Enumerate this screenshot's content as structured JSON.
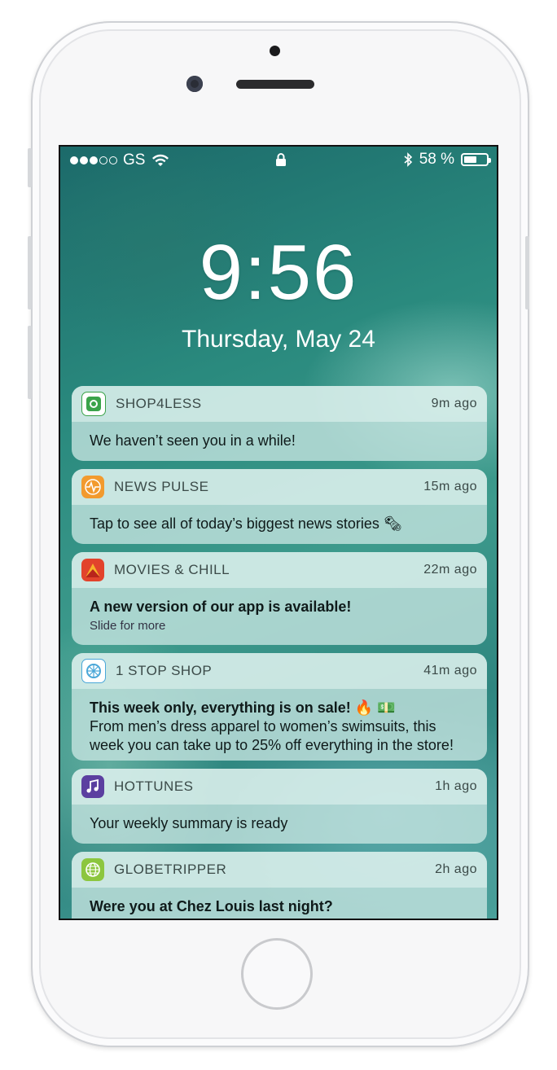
{
  "status_bar": {
    "carrier": "GS",
    "battery_text": "58 %",
    "battery_level": 0.58
  },
  "lock_screen": {
    "time": "9:56",
    "date": "Thursday, May 24"
  },
  "notifications": [
    {
      "app": "SHOP4LESS",
      "ago": "9m ago",
      "title": "",
      "message": "We haven’t seen you in a while!",
      "sub": "",
      "icon": "shop4less-icon"
    },
    {
      "app": "NEWS PULSE",
      "ago": "15m ago",
      "title": "",
      "message": "Tap to see all of today’s biggest news stories 🗞",
      "sub": "",
      "icon": "news-pulse-icon"
    },
    {
      "app": "MOVIES & CHILL",
      "ago": "22m ago",
      "title": "A new version of our app is available!",
      "message": "",
      "sub": "Slide for more",
      "icon": "movies-chill-icon"
    },
    {
      "app": "1 STOP SHOP",
      "ago": "41m ago",
      "title": "This week only, everything is on sale! 🔥 💵",
      "message": "From men’s dress apparel to women’s swimsuits, this week you can take up to 25% off everything in the store!",
      "sub": "",
      "icon": "one-stop-shop-icon"
    },
    {
      "app": "HOTTUNES",
      "ago": "1h ago",
      "title": "",
      "message": "Your weekly summary is ready",
      "sub": "",
      "icon": "hottunes-icon"
    },
    {
      "app": "GLOBETRIPPER",
      "ago": "2h ago",
      "title": "Were you at Chez Louis last night?",
      "message": "",
      "sub": "",
      "icon": "globetripper-icon"
    }
  ],
  "colors": {
    "shop4less": "#3aa34a",
    "news_pulse": "#f29a2e",
    "movies_chill": "#e2432c",
    "one_stop_shop": "#4aa7d8",
    "hottunes": "#5b3fa0",
    "globetripper": "#8cc63f"
  }
}
